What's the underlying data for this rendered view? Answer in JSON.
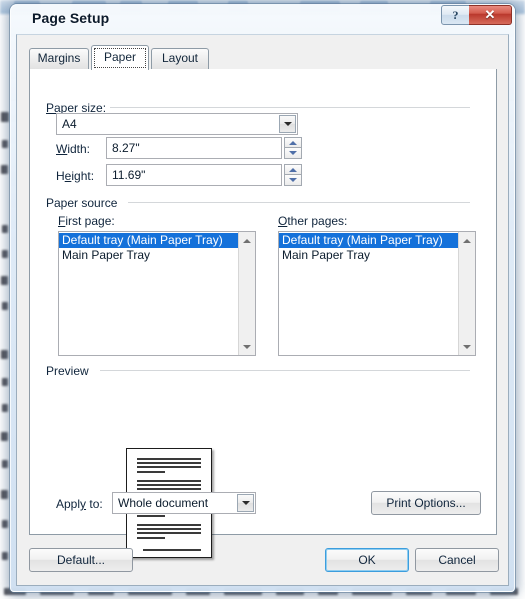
{
  "window": {
    "title": "Page Setup",
    "help_button": "?",
    "close_button": "✕",
    "help_icon": "question-mark-icon",
    "close_icon": "close-x-icon"
  },
  "tabs": [
    {
      "label": "Margins",
      "active": false
    },
    {
      "label": "Paper",
      "active": true
    },
    {
      "label": "Layout",
      "active": false
    }
  ],
  "paper_size": {
    "group_label": "Paper size:",
    "size_combo": {
      "value": "A4",
      "arrow_icon": "chevron-down-icon"
    },
    "width": {
      "label": "Width:",
      "value": "8.27\"",
      "spinner_up_icon": "spinner-up-icon",
      "spinner_down_icon": "spinner-down-icon"
    },
    "height": {
      "label": "Height:",
      "value": "11.69\"",
      "spinner_up_icon": "spinner-up-icon",
      "spinner_down_icon": "spinner-down-icon"
    }
  },
  "paper_source": {
    "group_label": "Paper source",
    "first_page": {
      "label": "First page:",
      "items": [
        {
          "text": "Default tray (Main Paper Tray)",
          "selected": true
        },
        {
          "text": "Main Paper Tray",
          "selected": false
        }
      ],
      "scroll_up_icon": "scroll-up-arrow-icon",
      "scroll_down_icon": "scroll-down-arrow-icon"
    },
    "other_pages": {
      "label": "Other pages:",
      "items": [
        {
          "text": "Default tray (Main Paper Tray)",
          "selected": true
        },
        {
          "text": "Main Paper Tray",
          "selected": false
        }
      ],
      "scroll_up_icon": "scroll-up-arrow-icon",
      "scroll_down_icon": "scroll-down-arrow-icon"
    }
  },
  "preview": {
    "group_label": "Preview",
    "page_paragraphs": 4,
    "lines_per_paragraph": 4,
    "trailing_lines": 1
  },
  "apply_to": {
    "label": "Apply to:",
    "value": "Whole document",
    "arrow_icon": "chevron-down-icon"
  },
  "buttons": {
    "print_options": "Print Options...",
    "default": "Default...",
    "ok": "OK",
    "cancel": "Cancel"
  },
  "colors": {
    "selection_blue": "#1471da",
    "focus_blue": "#3c9ddd",
    "close_red": "#b9372b",
    "dialog_face": "#f0f0f0"
  }
}
